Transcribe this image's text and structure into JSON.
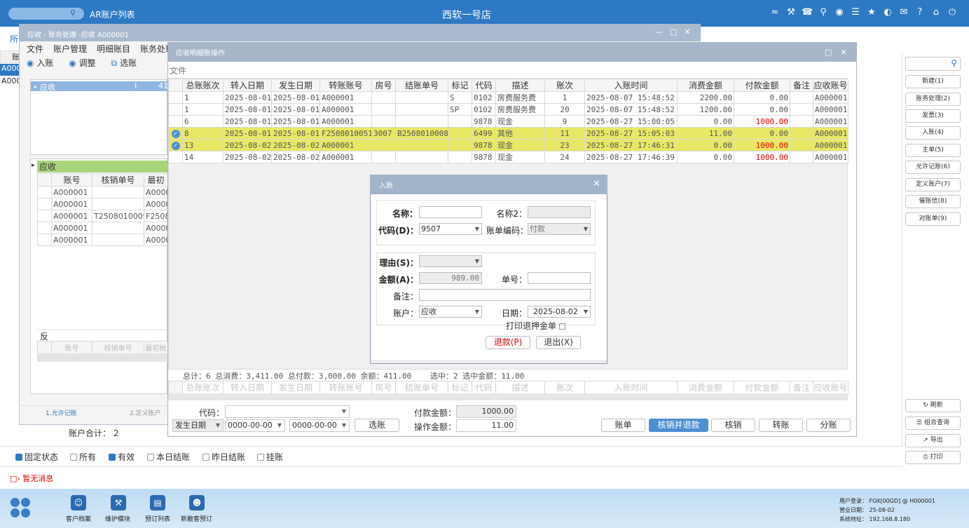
{
  "topbar": {
    "title": "AR账户列表",
    "center": "西软一号店"
  },
  "statusbar": {
    "checks": [
      {
        "label": "固定状态",
        "on": true
      },
      {
        "label": "所有",
        "on": false
      },
      {
        "label": "有效",
        "on": true
      },
      {
        "label": "本日结账",
        "on": false
      },
      {
        "label": "昨日结账",
        "on": false
      },
      {
        "label": "挂账",
        "on": false
      }
    ],
    "message": "暂无消息"
  },
  "bottombar": {
    "apps": [
      {
        "label": "客户档案"
      },
      {
        "label": "维护模块"
      },
      {
        "label": "预订列表"
      },
      {
        "label": "新散客预订"
      }
    ],
    "info": {
      "user_label": "用户登录：",
      "user_value": "FOX[00GD] @ H000001",
      "date_label": "营业日期：",
      "date_value": "25-08-02",
      "ip_label": "系统地址：",
      "ip_value": "192.168.8.180"
    }
  },
  "left_bg": {
    "tab": "所",
    "col": "账",
    "rows": [
      "A000",
      "A000"
    ],
    "account_total": "账户合计：  2"
  },
  "right_panel": {
    "buttons": [
      "新建(1)",
      "账务处理(2)",
      "发票(3)",
      "入账(4)",
      "主单(5)",
      "允许记账(6)",
      "定义账户(7)",
      "催账信(8)",
      "对账单(9)"
    ],
    "bottom_buttons": [
      "刷新",
      "组合查询",
      "导出",
      "打印"
    ]
  },
  "window1": {
    "title": "应收 - 账务处理 -应收  A000001",
    "menu": [
      "文件",
      "账户管理",
      "明细账目",
      "账务处理"
    ],
    "toolbar": [
      "入账",
      "调整",
      "选账"
    ],
    "tree_item": {
      "label": "应收",
      "code": "I",
      "value": "41"
    },
    "group_label": "应收",
    "headers": [
      "账号",
      "核销单号",
      "最初"
    ],
    "rows": [
      [
        "A000001",
        "",
        "A0000"
      ],
      [
        "A000001",
        "",
        "A0000"
      ],
      [
        "A000001",
        "T2508010009",
        "F2508"
      ],
      [
        "A000001",
        "",
        "A0000"
      ],
      [
        "A000001",
        "",
        "A0000"
      ]
    ],
    "rev_label": "反",
    "rev_headers": [
      "账号",
      "核销单号",
      "最初帐"
    ],
    "tabs": [
      "1.允许记账",
      "2.定义账户"
    ]
  },
  "window2": {
    "title": "应收明细账操作",
    "menu": "文件",
    "headers": [
      "总账账次",
      "转入日期",
      "发生日期",
      "转账账号",
      "房号",
      "结账单号",
      "标记",
      "代码",
      "描述",
      "账次",
      "入账时间",
      "消费金额",
      "付款金额",
      "备注",
      "应收账号"
    ],
    "rows": [
      {
        "check": false,
        "sel": false,
        "cells": [
          "1",
          "2025-08-01",
          "2025-08-01",
          "A000001",
          "",
          "",
          "S",
          "0102",
          "房费服务费",
          "1",
          "2025-08-07  15:48:52",
          "2200.00",
          "0.00",
          "",
          "A000001"
        ]
      },
      {
        "check": false,
        "sel": false,
        "cells": [
          "1",
          "2025-08-01",
          "2025-08-01",
          "A000001",
          "",
          "",
          "SP",
          "0102",
          "房费服务费",
          "20",
          "2025-08-07  15:48:52",
          "1200.00",
          "0.00",
          "",
          "A000001"
        ]
      },
      {
        "check": false,
        "sel": false,
        "cells": [
          "6",
          "2025-08-01",
          "2025-08-01",
          "A000001",
          "",
          "",
          "",
          "9878",
          "现金",
          "9",
          "2025-08-27  15:00:05",
          "0.00",
          "1000.00",
          "",
          "A000001"
        ]
      },
      {
        "check": true,
        "sel": true,
        "cells": [
          "8",
          "2025-08-01",
          "2025-08-01",
          "F2508010051",
          "3007",
          "B2508010008",
          "",
          "6499",
          "其他",
          "11",
          "2025-08-27  15:05:03",
          "11.00",
          "0.00",
          "",
          "A000001"
        ]
      },
      {
        "check": true,
        "sel": true,
        "cells": [
          "13",
          "2025-08-02",
          "2025-08-02",
          "A000001",
          "",
          "",
          "",
          "9878",
          "现金",
          "23",
          "2025-08-27  17:46:31",
          "0.00",
          "1000.00",
          "",
          "A000001"
        ]
      },
      {
        "check": false,
        "sel": false,
        "cells": [
          "14",
          "2025-08-02",
          "2025-08-02",
          "A000001",
          "",
          "",
          "",
          "9878",
          "现金",
          "24",
          "2025-08-27  17:46:39",
          "0.00",
          "1000.00",
          "",
          "A000001"
        ]
      }
    ],
    "summary": "总计：6 总消费：3,411.00 总付款：3,000.00 余额：411.00",
    "summary_sel": "选中：2 选中金额：11.00",
    "footer": {
      "code_label": "代码：",
      "date_select": "发生日期",
      "date_from": "0000-00-00",
      "date_to": "0000-00-00",
      "select_btn": "选账",
      "pay_label": "付款金额：",
      "pay_value": "1000.00",
      "op_label": "操作金额：",
      "op_value": "11.00",
      "buttons": [
        "账单",
        "核销并退款",
        "核销",
        "转账",
        "分账"
      ]
    }
  },
  "dialog": {
    "title": "入账",
    "name_label": "名称：",
    "name2_label": "名称2：",
    "code_label": "代码(D)：",
    "code_value": "9507",
    "acct_code_label": "账单编码：",
    "acct_code_value": "付款",
    "reason_label": "理由(S)：",
    "amount_label": "金额(A)：",
    "amount_value": "989.00",
    "bill_label": "单号：",
    "remark_label": "备注：",
    "account_label": "账户：",
    "account_value": "应收",
    "date_label": "日期：",
    "date_value": "2025-08-02",
    "print_label": "打印退押金单",
    "refund_btn": "退款(P)",
    "exit_btn": "退出(X)"
  }
}
